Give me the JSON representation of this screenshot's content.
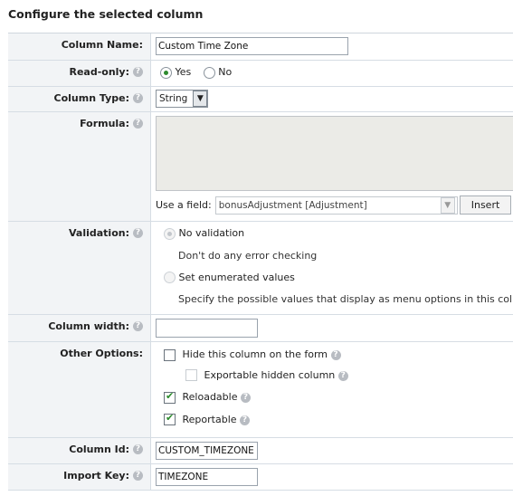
{
  "header": {
    "title": "Configure the selected column"
  },
  "fields": {
    "column_name": {
      "label": "Column Name:",
      "value": "Custom Time Zone"
    },
    "read_only": {
      "label": "Read-only:",
      "options": [
        "Yes",
        "No"
      ],
      "selected": "Yes"
    },
    "column_type": {
      "label": "Column Type:",
      "selected": "String"
    },
    "formula": {
      "label": "Formula:",
      "value": "",
      "use_field_label": "Use a field:",
      "use_field_selected": "bonusAdjustment [Adjustment]",
      "insert_label": "Insert"
    },
    "validation": {
      "label": "Validation:",
      "options": [
        {
          "label": "No validation",
          "description": "Don't do any error checking",
          "selected": true
        },
        {
          "label": "Set enumerated values",
          "description": "Specify the possible values that display as menu options in this col",
          "selected": false
        }
      ]
    },
    "column_width": {
      "label": "Column width:",
      "value": ""
    },
    "other_options": {
      "label": "Other Options:",
      "hide_column": {
        "label": "Hide this column on the form",
        "checked": false
      },
      "exportable_hidden": {
        "label": "Exportable hidden column",
        "checked": false
      },
      "reloadable": {
        "label": "Reloadable",
        "checked": true
      },
      "reportable": {
        "label": "Reportable",
        "checked": true
      }
    },
    "column_id": {
      "label": "Column Id:",
      "value": "CUSTOM_TIMEZONE"
    },
    "import_key": {
      "label": "Import Key:",
      "value": "TIMEZONE"
    }
  },
  "icons": {
    "help": "help-icon",
    "checkmark": "checkmark-icon",
    "dropdown": "dropdown-arrow-icon"
  },
  "colors": {
    "label_bg": "#f2f4f6",
    "border": "#d6dde4",
    "check": "#2a8a2a",
    "textarea_bg": "#ebebe7"
  }
}
